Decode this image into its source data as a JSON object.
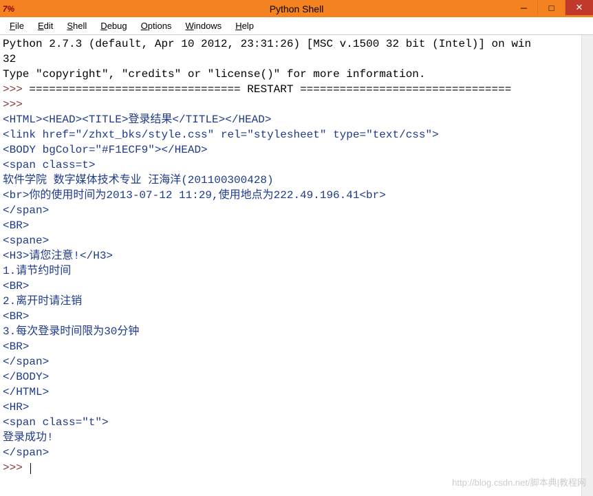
{
  "window": {
    "icon_text": "7%",
    "title": "Python Shell"
  },
  "window_controls": {
    "min": "─",
    "max": "□",
    "close": "✕"
  },
  "menu": {
    "items": [
      {
        "key": "F",
        "rest": "ile"
      },
      {
        "key": "E",
        "rest": "dit"
      },
      {
        "key": "S",
        "rest": "hell"
      },
      {
        "key": "D",
        "rest": "ebug"
      },
      {
        "key": "O",
        "rest": "ptions"
      },
      {
        "key": "W",
        "rest": "indows"
      },
      {
        "key": "H",
        "rest": "elp"
      }
    ]
  },
  "shell": {
    "header_line1": "Python 2.7.3 (default, Apr 10 2012, 23:31:26) [MSC v.1500 32 bit (Intel)] on win",
    "header_line2": "32",
    "header_line3": "Type \"copyright\", \"credits\" or \"license()\" for more information.",
    "restart_line_prefix": ">>> ",
    "restart_line": "================================ RESTART ================================",
    "prompt": ">>> ",
    "output_lines": [
      "<HTML><HEAD><TITLE>登录结果</TITLE></HEAD>",
      "<link href=\"/zhxt_bks/style.css\" rel=\"stylesheet\" type=\"text/css\">",
      "<BODY bgColor=\"#F1ECF9\"></HEAD>",
      "<span class=t>",
      "软件学院 数字媒体技术专业 汪海洋(201100300428)",
      "<br>你的使用时间为2013-07-12 11:29,使用地点为222.49.196.41<br>",
      "</span>",
      "<BR>",
      "<spane>",
      "<H3>请您注意!</H3>",
      "1.请节约时间",
      "<BR>",
      "2.离开时请注销",
      "<BR>",
      "3.每次登录时间限为30分钟",
      "<BR>",
      "</span>",
      "</BODY>",
      "</HTML>",
      "<HR>",
      "<span class=\"t\">",
      "登录成功!",
      "</span>",
      ""
    ]
  },
  "watermark": "http://blog.csdn.net/脚本典|教程网",
  "bg_hint": "0."
}
